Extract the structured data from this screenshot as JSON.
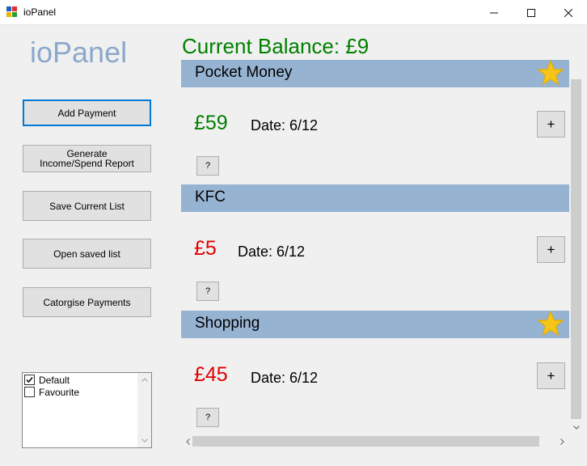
{
  "window": {
    "title": "ioPanel",
    "icon": "app-window-icon",
    "controls": [
      "minimize-icon",
      "maximize-icon",
      "close-icon"
    ]
  },
  "brand": "ioPanel",
  "sidebar": {
    "buttons": [
      {
        "label": "Add Payment",
        "focused": true
      },
      {
        "label": "Generate Income/Spend Report"
      },
      {
        "label": "Save Current List"
      },
      {
        "label": "Open saved list"
      },
      {
        "label": "Catorgise Payments"
      }
    ],
    "categories": [
      {
        "label": "Default",
        "checked": true
      },
      {
        "label": "Favourite",
        "checked": false
      }
    ]
  },
  "balance": "Current Balance: £9",
  "payments": [
    {
      "name": "Pocket Money",
      "amount": "£59",
      "date": "Date: 6/12",
      "favourite": true,
      "color": "#008000",
      "add_label": "+",
      "info_label": "?"
    },
    {
      "name": "KFC",
      "amount": "£5",
      "date": "Date: 6/12",
      "favourite": false,
      "color": "#e00000",
      "add_label": "+",
      "info_label": "?"
    },
    {
      "name": "Shopping",
      "amount": "£45",
      "date": "Date: 6/12",
      "favourite": true,
      "color": "#e00000",
      "add_label": "+",
      "info_label": "?"
    }
  ],
  "colors": {
    "header": "#97b3d2",
    "brand": "#8ba8cc",
    "balance": "#008000",
    "star": "#f5c518"
  }
}
